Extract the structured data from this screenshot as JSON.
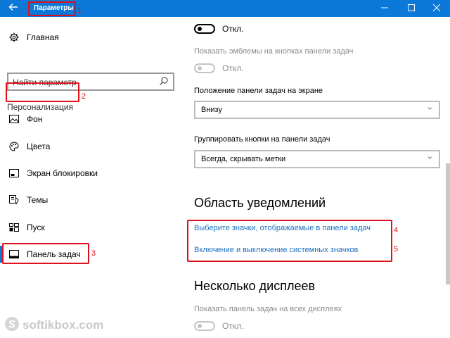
{
  "window": {
    "title": "Параметры",
    "back_icon": "back-arrow-icon",
    "controls": [
      "minimize",
      "maximize",
      "close"
    ]
  },
  "annotations": [
    "1",
    "2",
    "3",
    "4",
    "5"
  ],
  "sidebar": {
    "home_label": "Главная",
    "search_placeholder": "Найти параметр",
    "section_title": "Персонализация",
    "items": [
      {
        "label": "Фон",
        "icon": "image-icon"
      },
      {
        "label": "Цвета",
        "icon": "palette-icon"
      },
      {
        "label": "Экран блокировки",
        "icon": "lock-screen-icon"
      },
      {
        "label": "Темы",
        "icon": "themes-icon"
      },
      {
        "label": "Пуск",
        "icon": "start-icon"
      },
      {
        "label": "Панель задач",
        "icon": "taskbar-icon",
        "selected": true
      }
    ]
  },
  "main": {
    "toggle1": {
      "state_label": "Откл."
    },
    "badges_setting": {
      "label": "Показать эмблемы на кнопках панели задач",
      "state_label": "Откл.",
      "disabled": true
    },
    "position_setting": {
      "label": "Положение панели задач на экране",
      "value": "Внизу"
    },
    "group_setting": {
      "label": "Группировать кнопки на панели задач",
      "value": "Всегда, скрывать метки"
    },
    "notification_area": {
      "heading": "Область уведомлений",
      "link1": "Выберите значки, отображаемые в панели задач",
      "link2": "Включение и выключение системных значков"
    },
    "multi_display": {
      "heading": "Несколько дисплеев",
      "label": "Показать панель задач на всех дисплеях",
      "state_label": "Откл.",
      "disabled": true
    }
  },
  "watermark": {
    "text": "softikbox.com"
  },
  "colors": {
    "titlebar": "#0c78d7",
    "accent": "#0c78d7",
    "link": "#1a6fc0",
    "annotation": "#e0101a"
  }
}
